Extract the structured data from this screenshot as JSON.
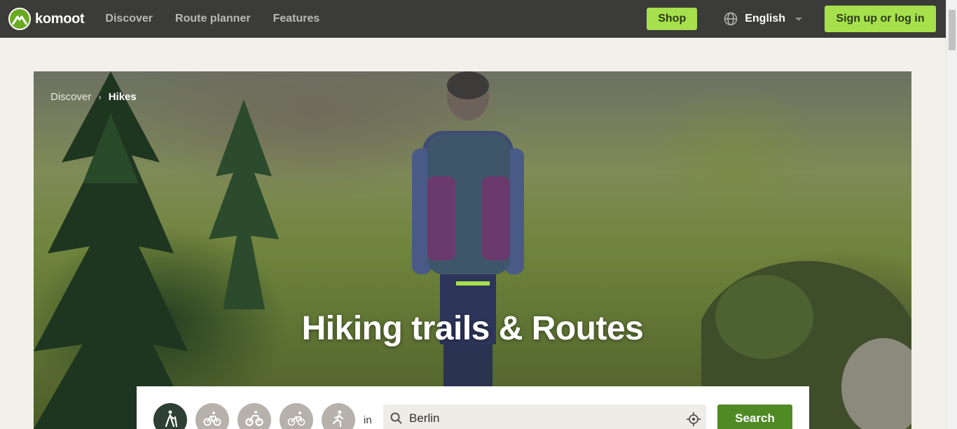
{
  "nav": {
    "logo_text": "komoot",
    "links": [
      "Discover",
      "Route planner",
      "Features"
    ],
    "shop_label": "Shop",
    "language_label": "English",
    "signup_label": "Sign up or log in"
  },
  "hero": {
    "breadcrumb": [
      "Discover",
      "Hikes"
    ],
    "breadcrumb_separator": "›",
    "title": "Hiking trails & Routes"
  },
  "search": {
    "in_label": "in",
    "location_value": "Berlin",
    "button_label": "Search",
    "sports": [
      {
        "icon": "hiking-icon",
        "active": true
      },
      {
        "icon": "bike-icon",
        "active": false
      },
      {
        "icon": "mountain-bike-icon",
        "active": false
      },
      {
        "icon": "road-bike-icon",
        "active": false
      },
      {
        "icon": "running-icon",
        "active": false
      }
    ]
  },
  "colors": {
    "topbar": "#3b3b3a",
    "brand_green": "#a6e14d",
    "search_button": "#4f8a25",
    "page_bg": "#f2f1e9"
  }
}
